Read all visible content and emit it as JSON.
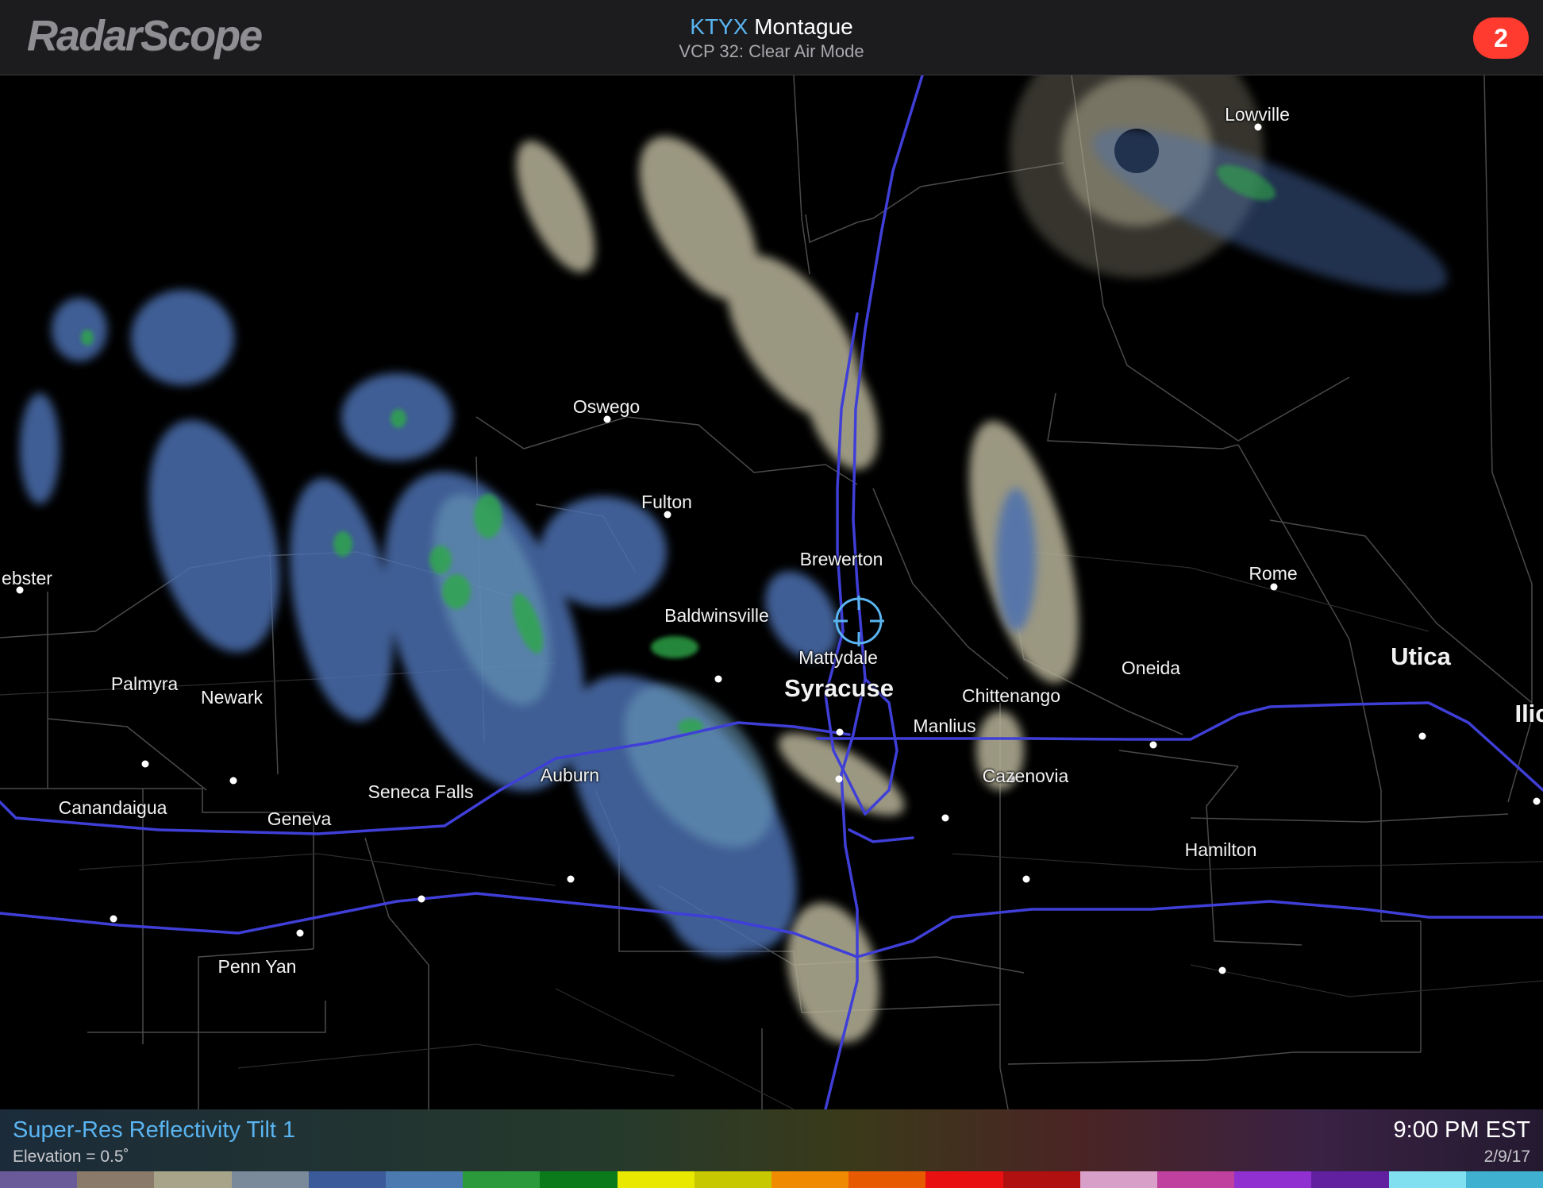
{
  "header": {
    "app_name": "RadarScope",
    "station_code": "KTYX",
    "station_name": "Montague",
    "vcp": "VCP 32: Clear Air Mode",
    "notification_count": "2"
  },
  "map": {
    "cities": [
      {
        "id": "lowville",
        "name": "Lowville"
      },
      {
        "id": "oswego",
        "name": "Oswego"
      },
      {
        "id": "fulton",
        "name": "Fulton"
      },
      {
        "id": "brewerton",
        "name": "Brewerton"
      },
      {
        "id": "webster",
        "name": "ebster"
      },
      {
        "id": "rome",
        "name": "Rome"
      },
      {
        "id": "baldwinsville",
        "name": "Baldwinsville"
      },
      {
        "id": "mattydale",
        "name": "Mattydale"
      },
      {
        "id": "oneida",
        "name": "Oneida"
      },
      {
        "id": "utica",
        "name": "Utica"
      },
      {
        "id": "palmyra",
        "name": "Palmyra"
      },
      {
        "id": "newark",
        "name": "Newark"
      },
      {
        "id": "syracuse",
        "name": "Syracuse"
      },
      {
        "id": "chittenango",
        "name": "Chittenango"
      },
      {
        "id": "ilion",
        "name": "Ilic"
      },
      {
        "id": "manlius",
        "name": "Manlius"
      },
      {
        "id": "auburn",
        "name": "Auburn"
      },
      {
        "id": "cazenovia",
        "name": "Cazenovia"
      },
      {
        "id": "seneca-falls",
        "name": "Seneca Falls"
      },
      {
        "id": "canandaigua",
        "name": "Canandaigua"
      },
      {
        "id": "geneva",
        "name": "Geneva"
      },
      {
        "id": "hamilton",
        "name": "Hamilton"
      },
      {
        "id": "penn-yan",
        "name": "Penn Yan"
      }
    ]
  },
  "footer": {
    "product": "Super-Res Reflectivity Tilt 1",
    "elevation": "Elevation = 0.5˚",
    "time": "9:00 PM EST",
    "date": "2/9/17"
  },
  "colors": {
    "accent": "#5ab4f0",
    "badge": "#ff3b30",
    "highway": "#3f3fd8",
    "light_echo": "#b8b49a",
    "moderate_echo": "#4b6fb0",
    "strong_echo": "#2ea84a",
    "scale": [
      "#6a5a9a",
      "#8a7a6a",
      "#a8a48a",
      "#7a8a9a",
      "#3a5a9a",
      "#4a7ab0",
      "#2a9a3a",
      "#0a7a1a",
      "#e8e800",
      "#c8c800",
      "#f08a00",
      "#e85a00",
      "#e81010",
      "#b01010",
      "#d8a0c8",
      "#c040a0",
      "#9030d0",
      "#6020a0",
      "#80e0f0",
      "#40b0d0"
    ]
  }
}
